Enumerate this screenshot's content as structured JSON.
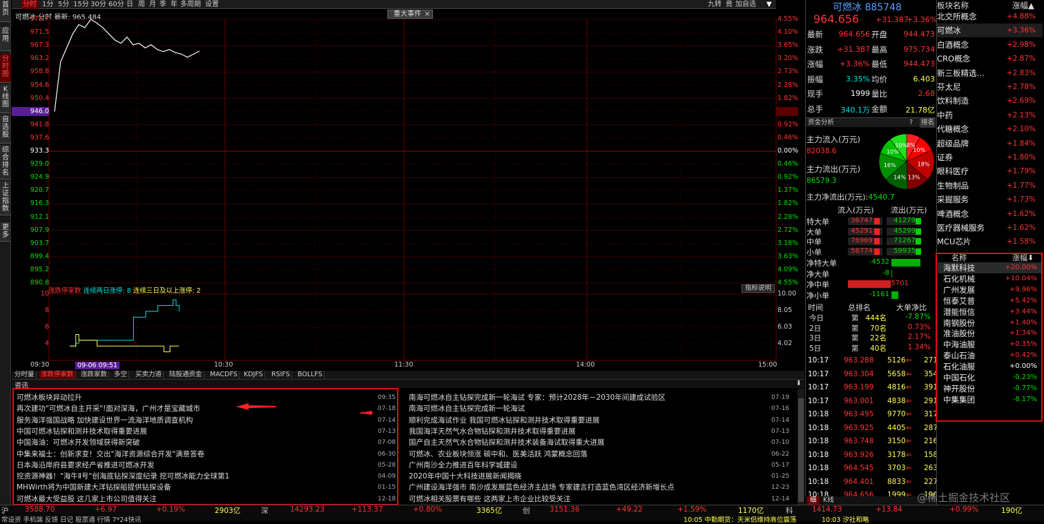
{
  "sidebar": {
    "tabs": [
      "首页",
      "应用",
      "分时图",
      "K线图",
      "自选股",
      "综合排名",
      "上证指数",
      "更多"
    ]
  },
  "topbar": {
    "tabs": [
      "分时",
      "1分",
      "5分",
      "15分",
      "30分",
      "60分",
      "日",
      "周",
      "月",
      "季",
      "年",
      "多周期",
      "设置"
    ],
    "right": [
      "九转",
      "竟",
      "加自选",
      "▼"
    ]
  },
  "chart": {
    "title": "可燃冰 分时 最新: 965.484",
    "event_button": "重大事件",
    "event_close": "×",
    "pre_close_label": "946.0",
    "left_axis": [
      "975.7",
      "971.5",
      "967.3",
      "963.2",
      "958.8",
      "954.6",
      "950.4",
      "946.0",
      "941.8",
      "937.6",
      "933.3",
      "929.0",
      "924.9",
      "920.7",
      "916.3",
      "912.1",
      "907.9",
      "903.7",
      "899.4",
      "895.2",
      "890.8"
    ],
    "right_axis": [
      "4.55%",
      "4.10%",
      "3.65%",
      "3.20%",
      "2.73%",
      "2.28%",
      "1.82%",
      "1.37%",
      "0.92%",
      "0.46%",
      "0.00%",
      "0.46%",
      "0.92%",
      "1.37%",
      "1.82%",
      "2.28%",
      "2.72%",
      "3.18%",
      "3.63%",
      "4.09%",
      "4.55%"
    ],
    "price_points": [
      [
        0,
        946
      ],
      [
        5,
        962
      ],
      [
        10,
        966.5
      ],
      [
        15,
        971
      ],
      [
        20,
        974
      ],
      [
        25,
        973
      ],
      [
        30,
        975.7
      ],
      [
        35,
        974.5
      ],
      [
        40,
        973
      ],
      [
        45,
        971
      ],
      [
        50,
        969
      ],
      [
        55,
        968
      ],
      [
        60,
        970
      ],
      [
        65,
        967.5
      ],
      [
        70,
        968
      ],
      [
        75,
        966.5
      ],
      [
        80,
        967.5
      ],
      [
        85,
        966
      ],
      [
        90,
        965.3
      ],
      [
        95,
        966
      ],
      [
        100,
        965
      ],
      [
        105,
        964.5
      ],
      [
        110,
        963.5
      ],
      [
        115,
        964.5
      ],
      [
        120,
        965.5
      ]
    ],
    "time_labels": [
      "09:30",
      "10:30",
      "11:30",
      "14:00",
      "15:00"
    ],
    "cursor_label": "09-06 09:51"
  },
  "sub": {
    "legend_red": "涨跌停家数",
    "legend_cyan": "连续两日涨停: 8",
    "legend_yel": "连续三日及以上涨停: 2",
    "indicator_button": "指标说明",
    "left_axis": [
      "10",
      "8",
      "6",
      "4"
    ],
    "right_axis": [
      "10.00",
      "8.05",
      "6.03",
      "4.02"
    ],
    "cyan_points": [
      [
        0,
        2
      ],
      [
        5,
        2
      ],
      [
        10,
        2.5
      ],
      [
        15,
        3
      ],
      [
        20,
        3
      ],
      [
        25,
        3
      ],
      [
        30,
        3
      ],
      [
        35,
        3
      ],
      [
        40,
        3
      ],
      [
        45,
        3
      ],
      [
        50,
        3
      ],
      [
        55,
        3
      ],
      [
        60,
        3
      ],
      [
        65,
        3
      ],
      [
        70,
        3
      ],
      [
        75,
        3
      ],
      [
        80,
        3
      ],
      [
        85,
        3
      ],
      [
        90,
        3
      ],
      [
        95,
        3
      ],
      [
        100,
        3
      ],
      [
        105,
        7
      ],
      [
        110,
        7
      ],
      [
        115,
        7
      ],
      [
        120,
        7
      ],
      [
        125,
        8
      ],
      [
        130,
        8
      ],
      [
        135,
        8
      ],
      [
        140,
        8
      ],
      [
        145,
        9
      ],
      [
        150,
        9
      ],
      [
        155,
        9
      ],
      [
        160,
        9
      ],
      [
        165,
        9
      ],
      [
        170,
        10
      ],
      [
        175,
        9
      ],
      [
        180,
        8
      ]
    ],
    "yel_points": [
      [
        0,
        2
      ],
      [
        5,
        2
      ],
      [
        10,
        4
      ],
      [
        15,
        3
      ],
      [
        20,
        3
      ],
      [
        25,
        3
      ],
      [
        30,
        3
      ],
      [
        35,
        3
      ],
      [
        40,
        3
      ],
      [
        45,
        2
      ],
      [
        50,
        2
      ],
      [
        55,
        2
      ],
      [
        60,
        2
      ],
      [
        65,
        2
      ],
      [
        70,
        2
      ],
      [
        75,
        2
      ],
      [
        80,
        2
      ],
      [
        85,
        2
      ],
      [
        90,
        2
      ],
      [
        95,
        2
      ],
      [
        100,
        2
      ],
      [
        105,
        2
      ],
      [
        110,
        2
      ],
      [
        115,
        2
      ],
      [
        120,
        2
      ],
      [
        125,
        2
      ],
      [
        130,
        2
      ],
      [
        135,
        2
      ],
      [
        140,
        2
      ],
      [
        145,
        2
      ],
      [
        150,
        2
      ],
      [
        155,
        1
      ],
      [
        160,
        1
      ],
      [
        165,
        2
      ],
      [
        170,
        2
      ],
      [
        175,
        2
      ],
      [
        180,
        2
      ]
    ]
  },
  "bottom_tabs": [
    "分时量",
    "涨跌停家数",
    "涨跌家数",
    "多空",
    "买卖力道",
    "陆股通资金",
    "MACDFS",
    "KDJFS",
    "RSIFS",
    "BOLLFS"
  ],
  "news": {
    "header": "资讯",
    "left": [
      [
        "可燃冰板块异动拉升",
        "09:35"
      ],
      [
        "再次建功\"可燃冰自主开采\"!面对深海，广州才是宝藏城市",
        "07-18"
      ],
      [
        "服务海洋强国战略 加快建设世界一流海洋地质调查机构",
        "07-14"
      ],
      [
        "中国可燃冰钻探和测井技术取得重要进展",
        "07-13"
      ],
      [
        "中国海油：可燃冰开发领域获得新突破",
        "07-08"
      ],
      [
        "中集来福士：创新求变！交出\"海洋资源综合开发\"满意答卷",
        "06-30"
      ],
      [
        "日本海沿岸府县要求经产省推进可燃冰开发",
        "05-28"
      ],
      [
        "挖资源神器！\"海牛Ⅱ号\"创海底钻探深度纪录 挖可燃冰能力全球第1",
        "04-09"
      ],
      [
        "MHWirth将为中国新建大洋钻探船提供钻探设备",
        "01-15"
      ],
      [
        "可燃冰最大受益股 这几家上市公司值得关注",
        "12-18"
      ]
    ],
    "right": [
      [
        "南海可燃冰自主钻探完成新一轮海试 专家：预计2028年－2030年间建成试验区",
        "07-19"
      ],
      [
        "南海可燃冰自主钻探完成新一轮海试",
        "07-16"
      ],
      [
        "顺利完成海试作业 我国可燃冰钻探和测井技术取得重要进展",
        "07-14"
      ],
      [
        "我国海洋天然气水合物钻探和测井技术取得重要进展",
        "07-13"
      ],
      [
        "国产自主天然气水合物钻探和测井技术装备海试取得重大进展",
        "07-10"
      ],
      [
        "可燃冰、农业板块领涨 碳中和、医美活跃 鸿蒙概念回落",
        "06-22"
      ],
      [
        "广州南沙全力推进百年科学城建设",
        "05-17"
      ],
      [
        "2020年中国十大科技进展新闻揭晓",
        "01-25"
      ],
      [
        "广州建设海洋强市 南沙成发展蓝色经济主战场 专家建言打造蓝色湾区经济新增长点",
        "12-23"
      ],
      [
        "可燃冰相关股票有哪些 这两家上市企业比较受关注",
        "12-14"
      ]
    ]
  },
  "quote": {
    "name": "可燃冰",
    "code": "885748",
    "price": "964.656",
    "change": "+31.387",
    "pct": "+3.36%",
    "rows": [
      [
        "最新",
        "964.656",
        "开盘",
        "944.473"
      ],
      [
        "涨跌",
        "+31.387",
        "最高",
        "975.734"
      ],
      [
        "涨幅",
        "+3.36%",
        "最低",
        "944.473"
      ],
      [
        "振幅",
        "3.35%",
        "均价",
        "6.403"
      ],
      [
        "现手",
        "1999",
        "量比",
        "2.68"
      ],
      [
        "总手",
        "340.1万",
        "金额",
        "21.78亿"
      ]
    ]
  },
  "capital": {
    "header": "资金分析",
    "help": "?",
    "rank": "排名",
    "inflow_label": "主力流入(万元)",
    "inflow": "82038.6",
    "outflow_label": "主力流出(万元)",
    "outflow": "86579.3",
    "net_label": "主力净流出(万元):",
    "net": "4540.7",
    "pie": [
      {
        "v": 8,
        "c": "#ff2020",
        "t": "8%"
      },
      {
        "v": 10,
        "c": "#ff0000",
        "t": "10%"
      },
      {
        "v": 18,
        "c": "#c00000",
        "t": "18%"
      },
      {
        "v": 13,
        "c": "#800000",
        "t": "13%"
      },
      {
        "v": 14,
        "c": "#006000",
        "t": "14%"
      },
      {
        "v": 16,
        "c": "#009000",
        "t": "16%"
      },
      {
        "v": 10,
        "c": "#00c000",
        "t": "10%"
      },
      {
        "v": 10,
        "c": "#20e020",
        "t": "10%"
      }
    ],
    "in_col": "流入(万元)",
    "out_col": "流出(万元)",
    "orders": [
      [
        "特大单",
        "36747",
        "41279"
      ],
      [
        "大单",
        "45291",
        "45299"
      ],
      [
        "中单",
        "76969",
        "71267"
      ],
      [
        "小单",
        "58774",
        "59935"
      ]
    ],
    "nets": [
      [
        "净特大单",
        "-4532",
        0.8
      ],
      [
        "净大单",
        "-8",
        0.02
      ],
      [
        "净中单",
        "5701",
        1
      ],
      [
        "净小单",
        "-1161",
        0.2
      ]
    ],
    "rank_head": [
      "时间",
      "总排名",
      "大单净比"
    ],
    "ranks": [
      [
        "今日",
        "第",
        "444名",
        "-7.87%"
      ],
      [
        "2日",
        "第",
        "70名",
        "0.73%"
      ],
      [
        "3日",
        "第",
        "22名",
        "2.17%"
      ],
      [
        "5日",
        "第",
        "40名",
        "1.34%"
      ]
    ]
  },
  "ticks": [
    [
      "10:17",
      "963.288",
      "5126",
      "271"
    ],
    [
      "10:17",
      "963.304",
      "5658",
      "354"
    ],
    [
      "10:17",
      "963.199",
      "4816",
      "391"
    ],
    [
      "10:17",
      "963.001",
      "4838",
      "291"
    ],
    [
      "10:18",
      "963.495",
      "9770",
      "317"
    ],
    [
      "10:18",
      "963.925",
      "4405",
      "287"
    ],
    [
      "10:18",
      "963.748",
      "3150",
      "216"
    ],
    [
      "10:18",
      "963.926",
      "3178",
      "158"
    ],
    [
      "10:18",
      "964.545",
      "3703",
      "263"
    ],
    [
      "10:18",
      "964.401",
      "8833",
      "227"
    ],
    [
      "10:18",
      "964.656",
      "1999",
      "190"
    ]
  ],
  "tick_tabs": [
    "细",
    "K线"
  ],
  "sectors": {
    "head": [
      "板块名称",
      "涨幅▲"
    ],
    "rows": [
      [
        "北交所概念",
        "+4.88%"
      ],
      [
        "可燃冰",
        "+3.36%"
      ],
      [
        "白酒概念",
        "+2.98%"
      ],
      [
        "CRO概念",
        "+2.87%"
      ],
      [
        "新三板精选…",
        "+2.83%"
      ],
      [
        "芬太尼",
        "+2.78%"
      ],
      [
        "饮料制造",
        "+2.69%"
      ],
      [
        "中药",
        "+2.13%"
      ],
      [
        "代糖概念",
        "+2.10%"
      ],
      [
        "超级品牌",
        "+1.84%"
      ],
      [
        "证券",
        "+1.80%"
      ],
      [
        "眼科医疗",
        "+1.79%"
      ],
      [
        "生物制品",
        "+1.77%"
      ],
      [
        "采掘服务",
        "+1.73%"
      ],
      [
        "啤酒概念",
        "+1.62%"
      ],
      [
        "医疗器械服务",
        "+1.62%"
      ],
      [
        "MCU芯片",
        "+1.58%"
      ]
    ]
  },
  "stocks": {
    "head": [
      "名称",
      "涨幅⬇"
    ],
    "rows": [
      [
        "海默科技",
        "+20.00%"
      ],
      [
        "石化机械",
        "+10.04%"
      ],
      [
        "广州发展",
        "+9.96%"
      ],
      [
        "恒泰艾普",
        "+5.42%"
      ],
      [
        "潜能恒信",
        "+3.44%"
      ],
      [
        "南钢股份",
        "+1.40%"
      ],
      [
        "准油股份",
        "+1.34%"
      ],
      [
        "中海油服",
        "+0.35%"
      ],
      [
        "泰山石油",
        "+0.42%"
      ],
      [
        "石化油服",
        "+0.00%"
      ],
      [
        "中国石化",
        "-0.23%"
      ],
      [
        "神开股份",
        "-0.77%"
      ],
      [
        "中集集团",
        "-8.17%"
      ]
    ]
  },
  "statusbar": {
    "sh": "沪",
    "sh_v": "3588.70",
    "sh_c": "+6.97",
    "sh_p": "+0.19%",
    "sh_amt": "2903亿",
    "sz": "深",
    "sz_v": "14293.23",
    "sz_c": "+113.37",
    "sz_p": "+0.80%",
    "sz_amt": "3365亿",
    "cy": "创",
    "cy_v": "3151.36",
    "cy_c": "+49.22",
    "cy_p": "+1.59%",
    "cy_amt": "1170亿",
    "k": "科",
    "k_v": "1414.73",
    "k_c": "+13.84",
    "k_p": "+0.99%",
    "k_amt": "190亿",
    "row2": "常设资 手机端 反馈 日记 股票通 行情 7*24快讯",
    "news2": "10:05 中勤期货：天米侣维持高位震荡",
    "news3": "10:03 汐社和略",
    "watermark": "@稀土掘金技术社区"
  }
}
